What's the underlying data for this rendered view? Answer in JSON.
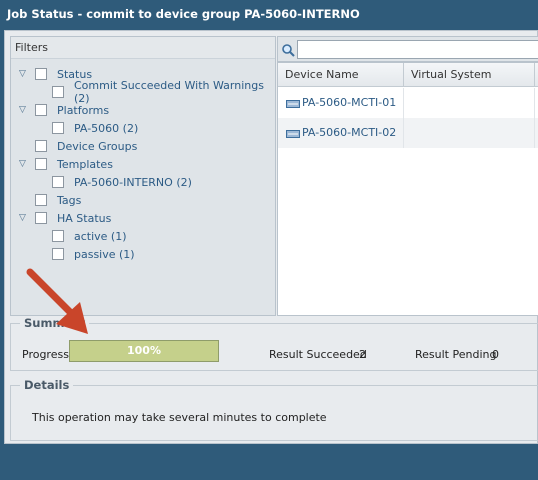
{
  "window": {
    "title": "Job Status - commit to device group PA-5060-INTERNO"
  },
  "filters": {
    "header": "Filters",
    "items": [
      {
        "label": "Status",
        "level": 0,
        "expandable": true
      },
      {
        "label": "Commit Succeeded With Warnings (2)",
        "level": 1,
        "expandable": false
      },
      {
        "label": "Platforms",
        "level": 0,
        "expandable": true
      },
      {
        "label": "PA-5060 (2)",
        "level": 1,
        "expandable": false
      },
      {
        "label": "Device Groups",
        "level": 0,
        "expandable": false
      },
      {
        "label": "Templates",
        "level": 0,
        "expandable": true
      },
      {
        "label": "PA-5060-INTERNO (2)",
        "level": 1,
        "expandable": false
      },
      {
        "label": "Tags",
        "level": 0,
        "expandable": false
      },
      {
        "label": "HA Status",
        "level": 0,
        "expandable": true
      },
      {
        "label": "active (1)",
        "level": 1,
        "expandable": false
      },
      {
        "label": "passive (1)",
        "level": 1,
        "expandable": false
      }
    ]
  },
  "search": {
    "value": "",
    "placeholder": ""
  },
  "grid": {
    "columns": [
      "Device Name",
      "Virtual System"
    ],
    "rows": [
      {
        "device_name": "PA-5060-MCTI-01",
        "virtual_system": ""
      },
      {
        "device_name": "PA-5060-MCTI-02",
        "virtual_system": ""
      }
    ]
  },
  "summary": {
    "legend": "Summary",
    "progress_label": "Progress",
    "progress_percent": 100,
    "progress_text": "100%",
    "result_succeeded_label": "Result Succeeded",
    "result_succeeded_value": "2",
    "result_pending_label": "Result Pending",
    "result_pending_value": "0"
  },
  "details": {
    "legend": "Details",
    "text": "This operation may take several minutes to complete"
  },
  "icons": {
    "tree_expand": "triangle-down-icon",
    "device": "device-icon",
    "search": "search-icon",
    "annotation_arrow": "red-arrow-icon"
  },
  "colors": {
    "titlebar": "#2f5b7a",
    "progress_fill": "#c5d08b",
    "link": "#2c5b85",
    "arrow": "#c9452a"
  }
}
